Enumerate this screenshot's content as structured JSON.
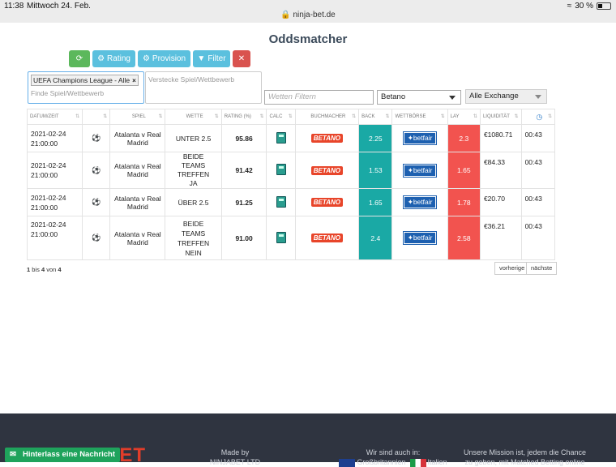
{
  "statusbar": {
    "time": "11:38",
    "date": "Mittwoch 24. Feb.",
    "url": "ninja-bet.de",
    "battery": "30 %"
  },
  "page": {
    "title": "Oddsmatcher"
  },
  "toolbar": {
    "rating": "Rating",
    "provision": "Provision",
    "filter": "Filter"
  },
  "filters": {
    "competition_tag": "UEFA Champions League - Alle",
    "find_placeholder": "Finde Spiel/Wettbewerb",
    "hide_placeholder": "Verstecke Spiel/Wettbewerb",
    "bets_placeholder": "Wetten Filtern",
    "bookmaker": "Betano",
    "exchange": "Alle Exchange"
  },
  "table": {
    "headers": [
      "DATUM/ZEIT",
      "",
      "SPIEL",
      "WETTE",
      "RATING (%)",
      "CALC",
      "BUCHMACHER",
      "BACK",
      "WETTBÖRSE",
      "LAY",
      "LIQUIDITÄT",
      ""
    ],
    "rows": [
      {
        "date": "2021-02-24",
        "time": "21:00:00",
        "game": "Atalanta v Real Madrid",
        "bet": "UNTER 2.5",
        "rating": "95.86",
        "bookmaker": "BETANO",
        "back": "2.25",
        "exchange": "betfair",
        "lay": "2.3",
        "liquidity": "€1080.71",
        "countdown": "00:43"
      },
      {
        "date": "2021-02-24",
        "time": "21:00:00",
        "game": "Atalanta v Real Madrid",
        "bet": "BEIDE TEAMS TREFFEN JA",
        "rating": "91.42",
        "bookmaker": "BETANO",
        "back": "1.53",
        "exchange": "betfair",
        "lay": "1.65",
        "liquidity": "€84.33",
        "countdown": "00:43"
      },
      {
        "date": "2021-02-24",
        "time": "21:00:00",
        "game": "Atalanta v Real Madrid",
        "bet": "ÜBER 2.5",
        "rating": "91.25",
        "bookmaker": "BETANO",
        "back": "1.65",
        "exchange": "betfair",
        "lay": "1.78",
        "liquidity": "€20.70",
        "countdown": "00:43"
      },
      {
        "date": "2021-02-24",
        "time": "21:00:00",
        "game": "Atalanta v Real Madrid",
        "bet": "BEIDE TEAMS TREFFEN NEIN",
        "rating": "91.00",
        "bookmaker": "BETANO",
        "back": "2.4",
        "exchange": "betfair",
        "lay": "2.58",
        "liquidity": "€36.21",
        "countdown": "00:43"
      }
    ]
  },
  "pager": {
    "from": "1",
    "mid": " bis ",
    "to": "4",
    "of": " von ",
    "total": "4",
    "prev": "vorherige",
    "next": "nächste"
  },
  "footer": {
    "made_by": "Made by",
    "company": "NINJABET LTD",
    "also": "Wir sind auch in:",
    "uk": "Großbritannien",
    "italy": "Italien",
    "mission1": "Unsere Mission ist, jedem die Chance",
    "mission2": "zu geben, mit Matched Betting online",
    "logo": "NINJABET"
  },
  "chat": {
    "label": "Hinterlass eine Nachricht"
  }
}
